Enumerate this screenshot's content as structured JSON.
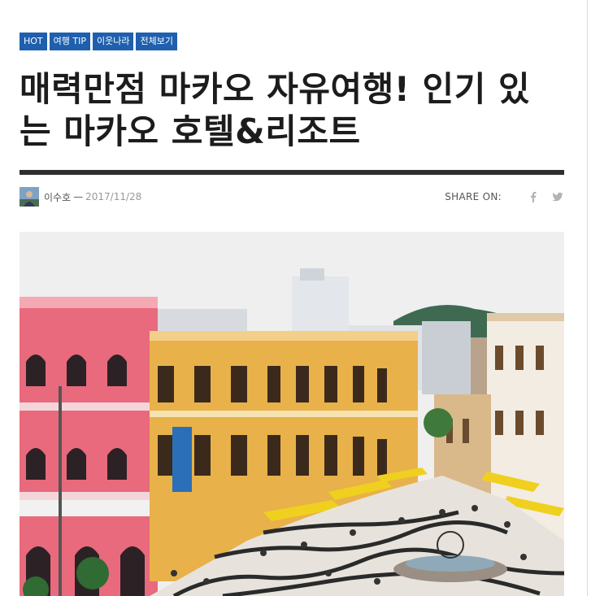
{
  "tags": [
    "HOT",
    "여행 TIP",
    "이웃나라",
    "전체보기"
  ],
  "article": {
    "title_line1": "매력만점 마카오 자유여행! 인기 있",
    "title_line2": "는 마카오 호텔&리조트"
  },
  "meta": {
    "author": "이수호",
    "separator": "—",
    "date": "2017/11/28"
  },
  "share": {
    "label": "SHARE ON:",
    "icons": [
      "facebook-icon",
      "twitter-icon"
    ]
  },
  "colors": {
    "tag_bg": "#1e5fae",
    "title": "#1c1c1c",
    "rule": "#2e2e2e"
  }
}
